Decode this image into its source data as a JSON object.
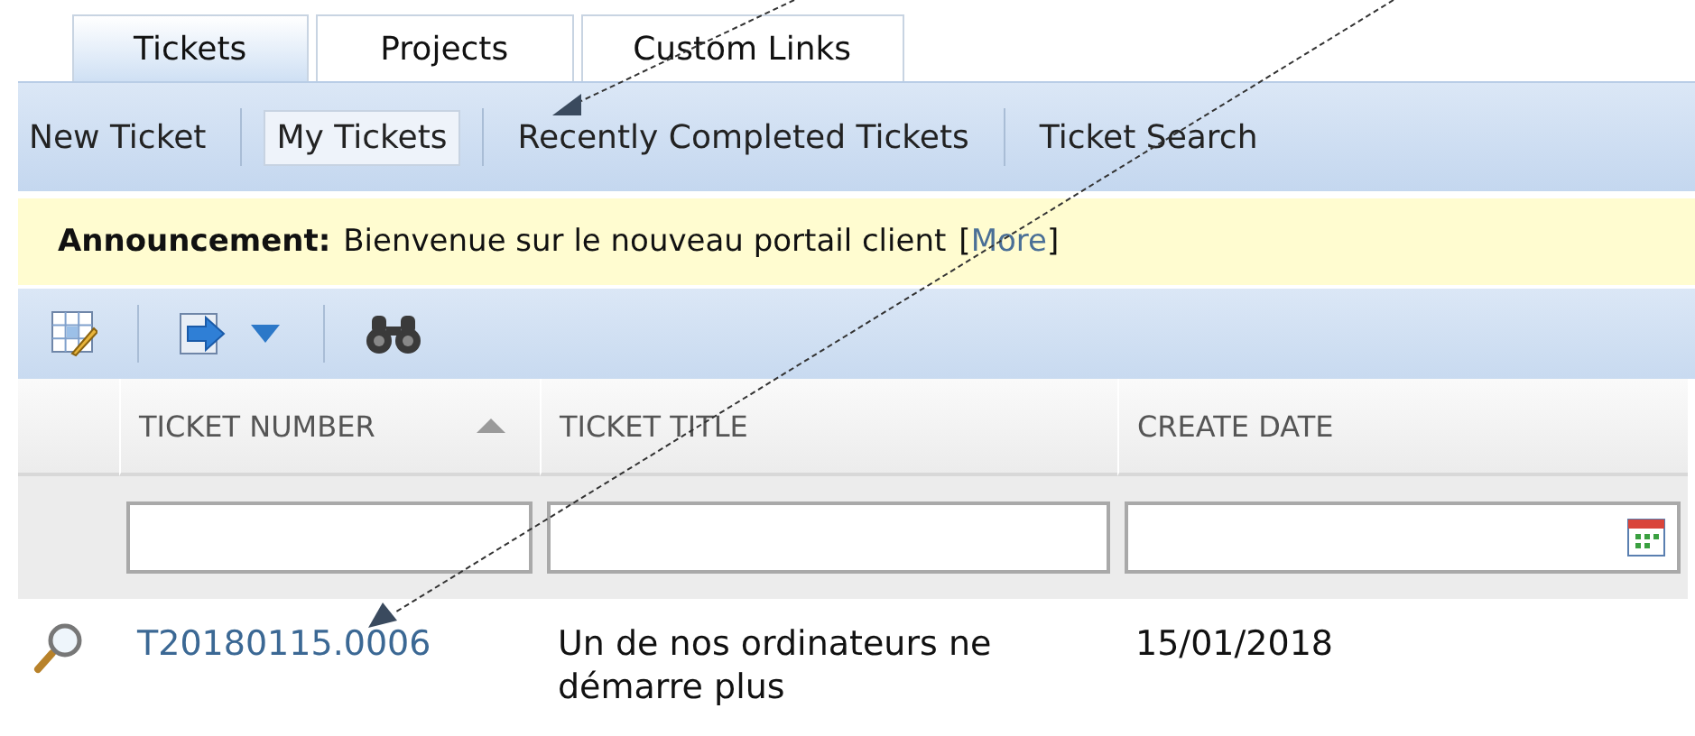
{
  "tabs": [
    {
      "label": "Tickets",
      "selected": true
    },
    {
      "label": "Projects",
      "selected": false
    },
    {
      "label": "Custom Links",
      "selected": false
    }
  ],
  "subnav": [
    {
      "label": "New Ticket",
      "selected": false
    },
    {
      "label": "My Tickets",
      "selected": true
    },
    {
      "label": "Recently Completed Tickets",
      "selected": false
    },
    {
      "label": "Ticket Search",
      "selected": false
    }
  ],
  "announcement": {
    "label": "Announcement:",
    "text": "Bienvenue sur le nouveau portail client",
    "bracket_open": "[",
    "link": "More",
    "bracket_close": "]"
  },
  "table": {
    "columns": [
      {
        "label": "TICKET NUMBER",
        "sorted": true
      },
      {
        "label": "TICKET TITLE",
        "sorted": false
      },
      {
        "label": "CREATE DATE",
        "sorted": false
      }
    ],
    "filters": [
      {
        "kind": "text"
      },
      {
        "kind": "text"
      },
      {
        "kind": "date"
      }
    ],
    "rows": [
      {
        "ticket_number": "T20180115.0006",
        "title": "Un de nos ordinateurs ne démarre plus",
        "create_date": "15/01/2018"
      }
    ]
  }
}
